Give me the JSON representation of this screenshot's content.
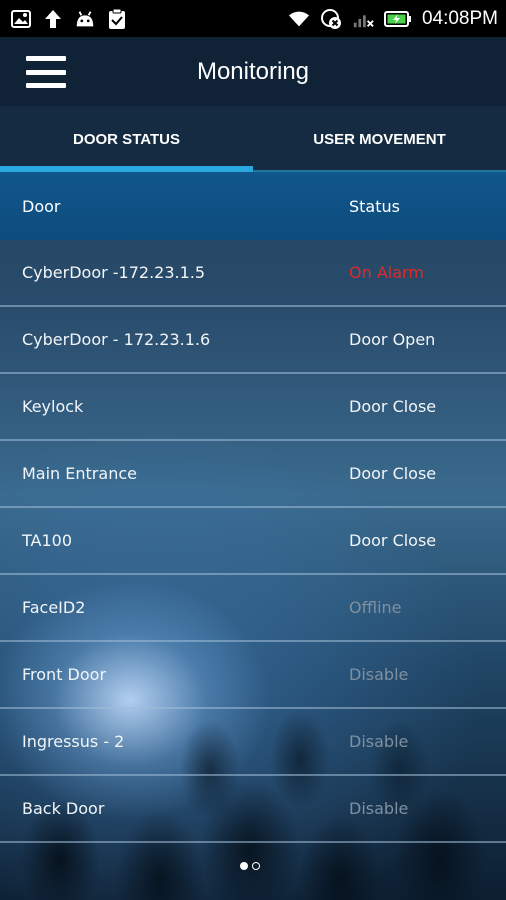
{
  "statusbar": {
    "time": "04:08PM",
    "icons": [
      "gallery-icon",
      "upload-icon",
      "android-icon",
      "clipboard-check-icon",
      "wifi-icon",
      "sync-blocked-icon",
      "signal-icon",
      "battery-charging-icon"
    ],
    "colors": {
      "battery": "#4cd04c"
    }
  },
  "appbar": {
    "title": "Monitoring"
  },
  "tabs": [
    {
      "label": "DOOR STATUS",
      "active": true
    },
    {
      "label": "USER MOVEMENT",
      "active": false
    }
  ],
  "table": {
    "headers": {
      "door": "Door",
      "status": "Status"
    },
    "rows": [
      {
        "door": "CyberDoor -172.23.1.5",
        "status": "On Alarm",
        "tone": "alarm"
      },
      {
        "door": "CyberDoor - 172.23.1.6",
        "status": "Door Open",
        "tone": "normal"
      },
      {
        "door": "Keylock",
        "status": "Door Close",
        "tone": "normal"
      },
      {
        "door": "Main Entrance",
        "status": "Door Close",
        "tone": "normal"
      },
      {
        "door": "TA100",
        "status": "Door Close",
        "tone": "normal"
      },
      {
        "door": "FaceID2",
        "status": "Offline",
        "tone": "dim"
      },
      {
        "door": "Front Door",
        "status": "Disable",
        "tone": "dim"
      },
      {
        "door": "Ingressus - 2",
        "status": "Disable",
        "tone": "dim"
      },
      {
        "door": "Back Door",
        "status": "Disable",
        "tone": "dim"
      }
    ]
  },
  "pager": {
    "pages": 2,
    "current": 1
  },
  "colors": {
    "accent": "#2aa8e0",
    "alarm": "#e02929",
    "dim": "#7f90a0"
  }
}
